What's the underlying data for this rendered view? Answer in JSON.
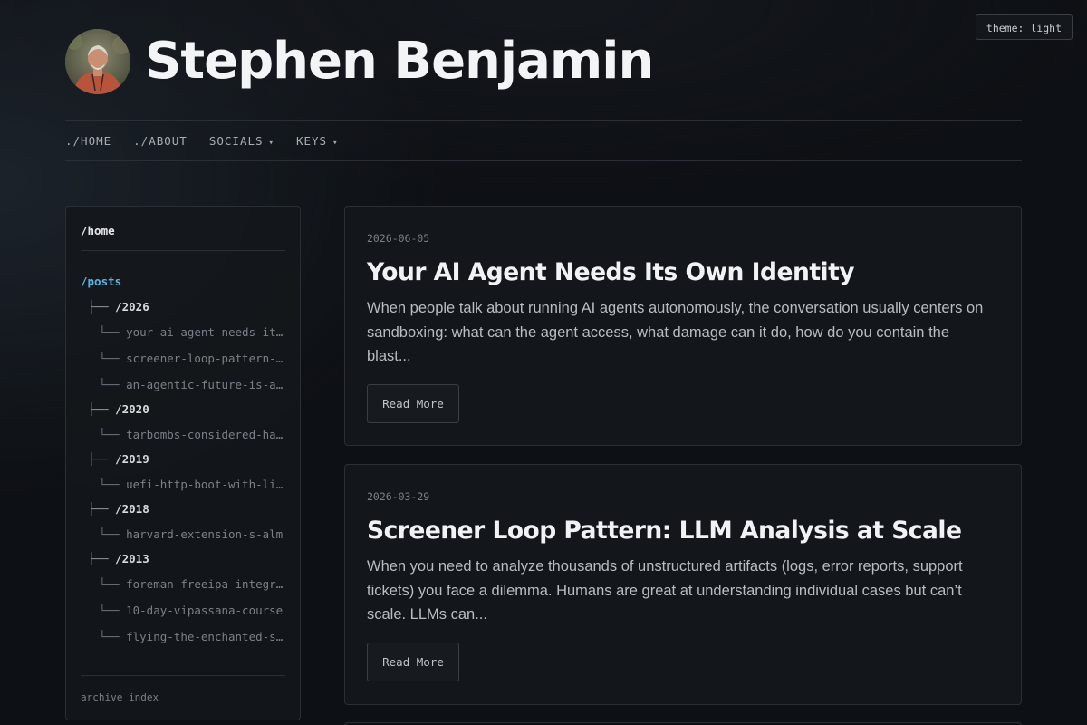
{
  "theme_toggle": {
    "label": "theme: light"
  },
  "header": {
    "title": "Stephen Benjamin"
  },
  "nav": [
    {
      "label": "./HOME",
      "has_dropdown": false
    },
    {
      "label": "./ABOUT",
      "has_dropdown": false
    },
    {
      "label": "SOCIALS",
      "has_dropdown": true
    },
    {
      "label": "KEYS",
      "has_dropdown": true
    }
  ],
  "sidebar": {
    "home": "/home",
    "posts_label": "/posts",
    "branch_year": "├──",
    "branch_post": "└──",
    "tree": [
      {
        "year": "/2026",
        "posts": [
          "your-ai-agent-needs-its-own-identity",
          "screener-loop-pattern-llm-analysis-at-scale",
          "an-agentic-future-is-already-here"
        ]
      },
      {
        "year": "/2020",
        "posts": [
          "tarbombs-considered-harmful"
        ]
      },
      {
        "year": "/2019",
        "posts": [
          "uefi-http-boot-with-libvirt"
        ]
      },
      {
        "year": "/2018",
        "posts": [
          "harvard-extension-s-alm"
        ]
      },
      {
        "year": "/2013",
        "posts": [
          "foreman-freeipa-integration",
          "10-day-vipassana-course",
          "flying-the-enchanted-skies"
        ]
      }
    ],
    "footer": "archive index"
  },
  "posts": [
    {
      "date": "2026-06-05",
      "title": "Your AI Agent Needs Its Own Identity",
      "excerpt": "When people talk about running AI agents autonomously, the conversation usually centers on sandboxing: what can the agent access, what damage can it do, how do you contain the blast...",
      "read_more": "Read More"
    },
    {
      "date": "2026-03-29",
      "title": "Screener Loop Pattern: LLM Analysis at Scale",
      "excerpt": "When you need to analyze thousands of unstructured artifacts (logs, error reports, support tickets) you face a dilemma. Humans are great at understanding individual cases but can’t scale. LLMs can...",
      "read_more": "Read More"
    }
  ],
  "colors": {
    "background": "#0d1014",
    "accent_posts": "#5fb0e0",
    "border": "#2b2f35"
  },
  "icons": {
    "nav_dropdown": "caret-down-icon",
    "avatar": "profile-photo"
  }
}
